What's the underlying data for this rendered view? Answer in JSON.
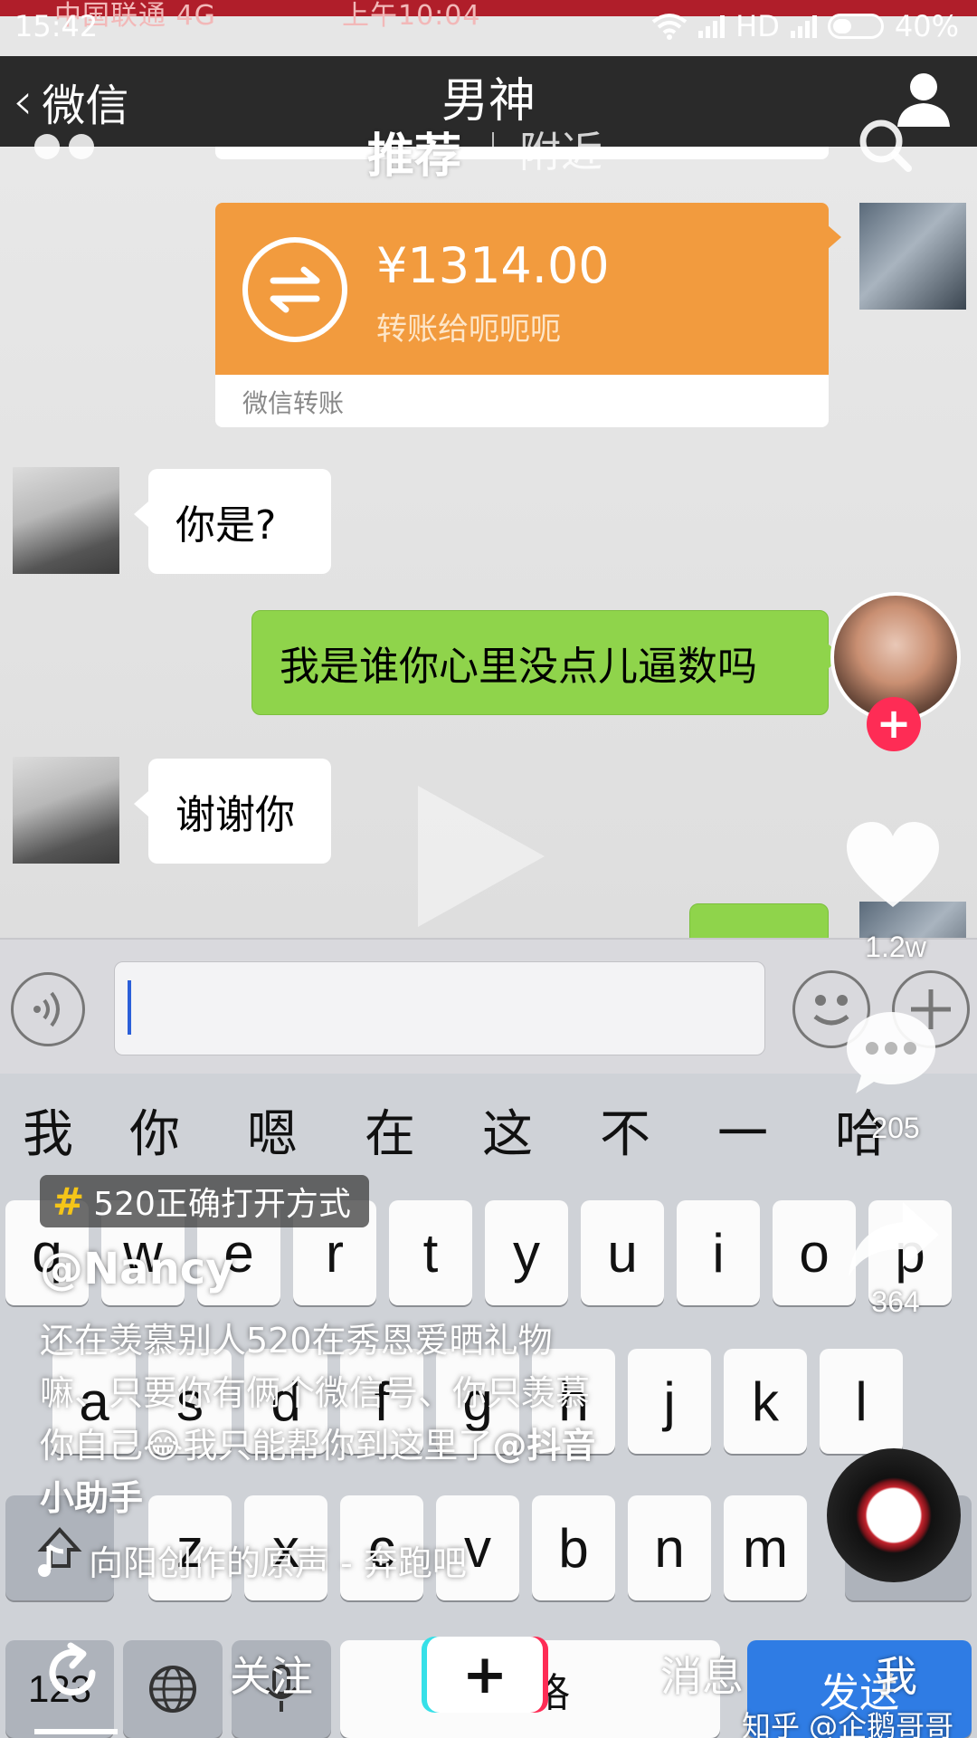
{
  "status_bar": {
    "time": "15:42",
    "faint_left": "中国联通  4G",
    "faint_center": "上午10:04",
    "hd": "HD",
    "battery": "40%"
  },
  "wechat_header": {
    "back_label": "微信",
    "title": "男神"
  },
  "douyin_tabs": {
    "recommend": "推荐",
    "nearby": "附近"
  },
  "transfer": {
    "amount": "¥1314.00",
    "description": "转账给呃呃呃",
    "footer": "微信转账",
    "color": "#f29b3e"
  },
  "messages": [
    {
      "side": "left",
      "text": "你是?"
    },
    {
      "side": "right",
      "text": "我是谁你心里没点儿逼数吗"
    },
    {
      "side": "left",
      "text": "谢谢你"
    }
  ],
  "keyboard": {
    "suggestions": [
      "我",
      "你",
      "嗯",
      "在",
      "这",
      "不",
      "一",
      "哈"
    ],
    "row1": [
      "q",
      "w",
      "e",
      "r",
      "t",
      "y",
      "u",
      "i",
      "o",
      "p"
    ],
    "row2": [
      "a",
      "s",
      "d",
      "f",
      "g",
      "h",
      "j",
      "k",
      "l"
    ],
    "row3": [
      "z",
      "x",
      "c",
      "v",
      "b",
      "n",
      "m"
    ],
    "numbers_key": "123",
    "space_key": "空格",
    "go_key": "发送"
  },
  "douyin": {
    "like_count": "1.2w",
    "comment_count": "205",
    "share_count": "364",
    "hashtag": "520正确打开方式",
    "username": "@Nancy",
    "caption_line1": "还在羡慕别人520在秀恩爱晒礼物",
    "caption_line2": "嘛、只要你有俩个微信号、你只羡慕",
    "caption_line3a": "你自己😂我只能帮你到这里了",
    "caption_mention": "@抖音",
    "caption_line4": "小助手",
    "music": "向阳创作的原声 - 奔跑吧",
    "nav_follow": "关注",
    "nav_inbox": "消息",
    "nav_me": "我",
    "create_plus": "+",
    "accent_pink": "#fe2c55",
    "accent_cyan": "#36e0e8"
  },
  "watermark": "知乎 @企鹅哥哥"
}
